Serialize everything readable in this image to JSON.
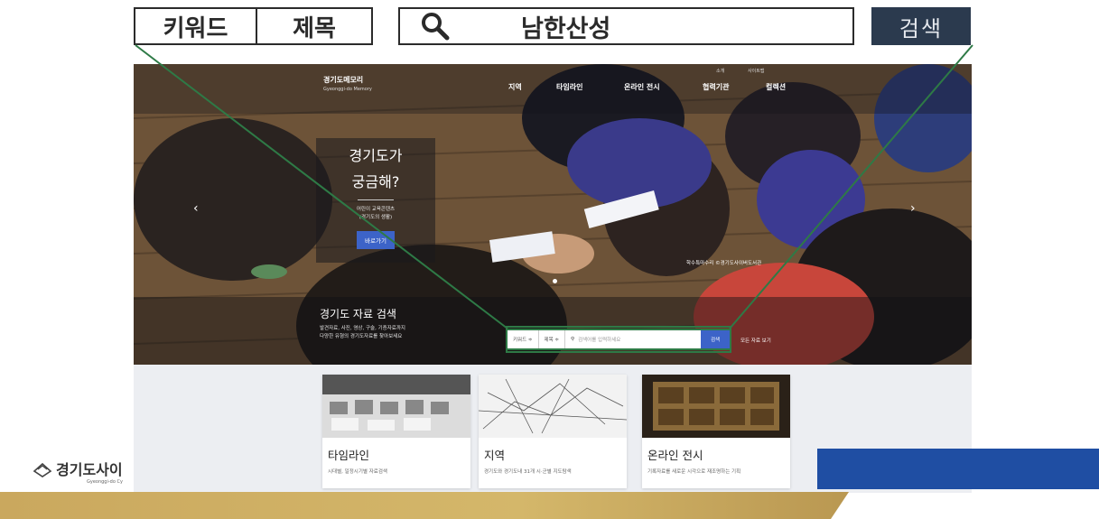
{
  "callout_search": {
    "filter_keyword": "키워드",
    "filter_title": "제목",
    "query": "남한산성",
    "search_button": "검색"
  },
  "site": {
    "logo_kr": "경기도메모리",
    "logo_en": "Gyeonggi-do Memory",
    "util_links": [
      "소개",
      "사이트맵"
    ],
    "nav": [
      "지역",
      "타임라인",
      "온라인 전시",
      "협력기관",
      "컬렉션"
    ],
    "promo": {
      "headline_1": "경기도가",
      "headline_2": "궁금해?",
      "sub_1": "어린이 교육콘텐츠",
      "sub_2": "(경기도의 생활)",
      "button": "바로가기"
    },
    "photo_credit": "학수특마수리 ©경기도사이버도서관",
    "search": {
      "title": "경기도 자료 검색",
      "desc_1": "발견자료, 사진, 영상, 구술, 기증자료까지",
      "desc_2": "다양한 유형의 경기도자료를 찾아보세요",
      "select_1": "키워드 ≑",
      "select_2": "제목 ≑",
      "placeholder": "검색어를 입력하세요",
      "button": "검색",
      "view_all": "모든 자료 보기"
    },
    "cards": [
      {
        "title": "타임라인",
        "sub": "시대별, 일정시기별 자료검색"
      },
      {
        "title": "지역",
        "sub": "경기도와 경기도내 31개 시·군별 지도탐색"
      },
      {
        "title": "온라인 전시",
        "sub": "기록자료를 새로운 시각으로 재조명하는 기획"
      }
    ]
  },
  "footer": {
    "logo_text": "경기도사이",
    "logo_sub": "Gyeonggi-do Cy"
  },
  "colors": {
    "callout_line": "#2e7a46",
    "search_blue": "#3c63c8",
    "brand_blue": "#1f4ea3",
    "gold": "#caa85e",
    "dark_button": "#2b3a4e"
  }
}
